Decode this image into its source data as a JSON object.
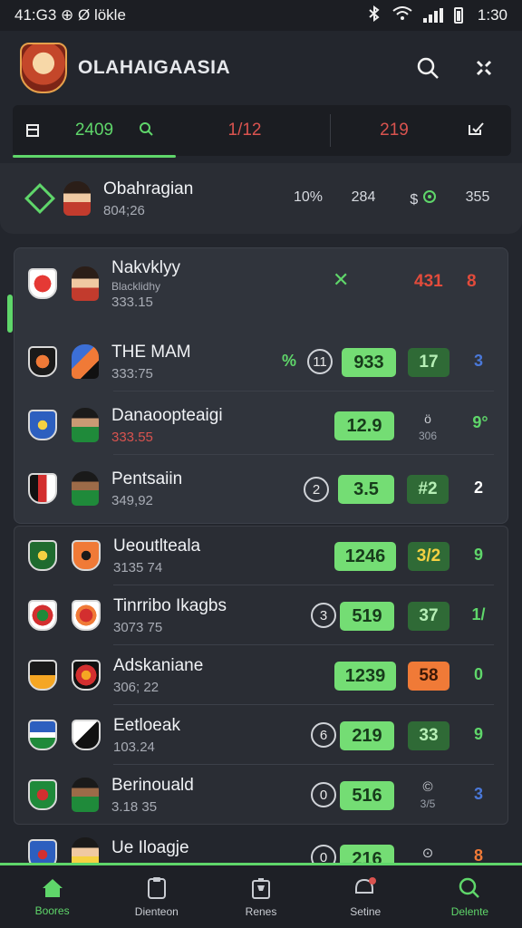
{
  "status_bar": {
    "time": "41:G3 ⊕ Ø lökle",
    "clock": "1:30"
  },
  "header": {
    "title": "OLAHAIGAASIA"
  },
  "filter": {
    "v1": "2409",
    "v2": "1/12",
    "v3": "219"
  },
  "featured": {
    "name": "Obahragian",
    "sub": "804;26",
    "s1": "10%",
    "s2": "284",
    "s3": "$",
    "s4": "355"
  },
  "rows": [
    {
      "name": "Nakvklyy",
      "sub": "Blacklidhy",
      "sub2": "333.15",
      "mid": "✕",
      "val": "431",
      "end": "8"
    },
    {
      "name": "THE MAM",
      "sub": "333:75",
      "tag": "%",
      "circle": "11",
      "pill": "933",
      "dpill": "17",
      "end": "3"
    },
    {
      "name": "Danaoopteaigi",
      "sub": "333.55",
      "pill": "12.9",
      "small": "ö",
      "smallsub": "306",
      "end": "9°"
    },
    {
      "name": "Pentsaiin",
      "sub": "349,92",
      "circle": "2",
      "pill": "3.5",
      "dpill": "#2",
      "end": "2"
    },
    {
      "name": "Ueoutlteala",
      "sub": "3135 74",
      "pill": "1246",
      "dpill": "3/2",
      "end": "9"
    },
    {
      "name": "Tinrribo Ikagbs",
      "sub": "3073 75",
      "circle": "3",
      "pill": "519",
      "dpill": "37",
      "end": "1/"
    },
    {
      "name": "Adskaniane",
      "sub": "306; 22",
      "pill": "1239",
      "opill": "58",
      "end": "0"
    },
    {
      "name": "Eetloeak",
      "sub": "103.24",
      "circle": "6",
      "pill": "219",
      "dpill": "33",
      "end": "9"
    },
    {
      "name": "Berinouald",
      "sub": "3.18 35",
      "circle": "0",
      "pill": "516",
      "small": "©",
      "smallsub": "3/5",
      "end": "3"
    },
    {
      "name": "Ue Iloagje",
      "sub": "",
      "circle": "0",
      "pill": "216",
      "small": "⊙",
      "end": "8"
    }
  ],
  "nav": [
    {
      "label": "Boores",
      "icon": "home-icon"
    },
    {
      "label": "Dienteon",
      "icon": "clipboard-icon"
    },
    {
      "label": "Renes",
      "icon": "trophy-icon"
    },
    {
      "label": "Setine",
      "icon": "bell-icon"
    },
    {
      "label": "Delente",
      "icon": "search-icon"
    }
  ],
  "colors": {
    "accent": "#5fd66a",
    "red": "#d9534f",
    "orange": "#f07a37",
    "dark_green": "#2f6a36"
  }
}
